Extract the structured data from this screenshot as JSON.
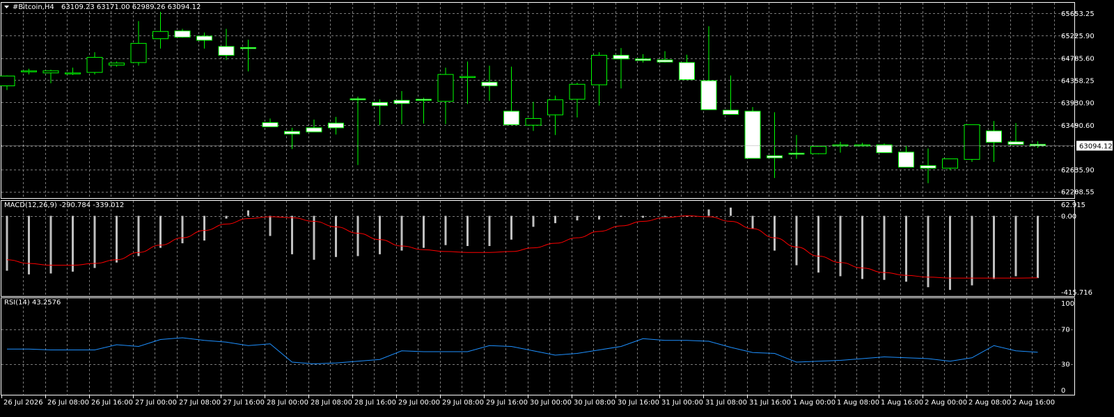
{
  "header": {
    "symbol_label": "#Bitcoin,H4",
    "ohlc": "63109.23 63171.00 62989.26 63094.12",
    "dropdown_icon": "triangle-down-icon"
  },
  "colors": {
    "background": "#000000",
    "grid": "#7a7a7a",
    "bull_body": "#000000",
    "bear_body": "#ffffff",
    "candle_outline": "#00ff00",
    "macd_hist": "#c0c0c0",
    "macd_signal": "#ff0000",
    "rsi_line": "#1e90ff"
  },
  "price_panel": {
    "ticks": [
      "65653.25",
      "65225.90",
      "64785.60",
      "64358.25",
      "63930.90",
      "63490.60",
      "63094.12",
      "62635.90",
      "62208.55"
    ],
    "current_price": "63094.12"
  },
  "macd_panel": {
    "label": "MACD(12,26,9) -290.784 -339.012",
    "ticks": [
      "62.915",
      "0.00",
      "-415.716"
    ]
  },
  "rsi_panel": {
    "label": "RSI(14) 43.2576",
    "ticks": [
      "100",
      "70",
      "30",
      "0"
    ]
  },
  "time_axis": {
    "labels": [
      "26 Jul 2026",
      "26 Jul 08:00",
      "26 Jul 16:00",
      "27 Jul 00:00",
      "27 Jul 08:00",
      "27 Jul 16:00",
      "28 Jul 00:00",
      "28 Jul 08:00",
      "28 Jul 16:00",
      "29 Jul 00:00",
      "29 Jul 08:00",
      "29 Jul 16:00",
      "30 Jul 00:00",
      "30 Jul 08:00",
      "30 Jul 16:00",
      "31 Jul 00:00",
      "31 Jul 08:00",
      "31 Jul 16:00",
      "1 Aug 00:00",
      "1 Aug 08:00",
      "1 Aug 16:00",
      "2 Aug 00:00",
      "2 Aug 08:00",
      "2 Aug 16:00"
    ]
  },
  "chart_data": [
    {
      "type": "candlestick",
      "title": "#Bitcoin,H4",
      "ylim": [
        62150,
        65800
      ],
      "open": [
        64250,
        64530,
        64500,
        64480,
        64510,
        64650,
        64700,
        65160,
        65310,
        65210,
        65010,
        64990,
        63540,
        63370,
        63440,
        63530,
        64000,
        63930,
        63970,
        63990,
        63950,
        64420,
        64320,
        63760,
        63490,
        63690,
        63990,
        64270,
        64840,
        64770,
        64750,
        64700,
        64350,
        63780,
        63760,
        62900,
        62950,
        62940,
        63110,
        63110,
        63110,
        62970,
        62710,
        62660,
        62830,
        63380,
        63170,
        63120
      ],
      "high": [
        64450,
        64580,
        64560,
        64600,
        64900,
        64720,
        65500,
        65680,
        65350,
        65280,
        65350,
        65140,
        63620,
        63440,
        63600,
        63650,
        64040,
        63990,
        64150,
        64020,
        64600,
        64720,
        64640,
        64620,
        63940,
        64060,
        64310,
        64900,
        64980,
        64860,
        64920,
        64850,
        65400,
        64450,
        63840,
        63740,
        63300,
        63020,
        63170,
        63150,
        63140,
        63090,
        63040,
        62690,
        62880,
        63570,
        63530,
        63180
      ],
      "low": [
        64170,
        64470,
        64300,
        64460,
        64470,
        64620,
        64640,
        64970,
        65180,
        64970,
        64750,
        64530,
        63500,
        63030,
        63360,
        63310,
        62720,
        63490,
        63510,
        63520,
        63510,
        63900,
        63960,
        63660,
        63380,
        63300,
        63640,
        63870,
        64200,
        64700,
        64700,
        64680,
        64260,
        63720,
        63620,
        62470,
        62840,
        62930,
        62960,
        63080,
        63080,
        62940,
        62370,
        62620,
        62780,
        62780,
        63120,
        63050
      ],
      "close": [
        64440,
        64540,
        64540,
        64500,
        64800,
        64690,
        65070,
        65300,
        65190,
        65130,
        64840,
        64980,
        63460,
        63320,
        63360,
        63440,
        63980,
        63870,
        63910,
        63970,
        64470,
        64430,
        64250,
        63500,
        63620,
        63980,
        64280,
        64840,
        64770,
        64740,
        64710,
        64370,
        63790,
        63700,
        62850,
        62860,
        62940,
        63080,
        63110,
        63110,
        62960,
        62680,
        62660,
        62840,
        63500,
        63160,
        63120,
        63094.12
      ]
    },
    {
      "type": "bar",
      "title": "MACD(12,26,9)",
      "ylim": [
        -415.716,
        62.915
      ],
      "series": [
        {
          "name": "MACD",
          "values": [
            -300,
            -320,
            -315,
            -305,
            -285,
            -255,
            -220,
            -175,
            -150,
            -135,
            -15,
            30,
            -110,
            -210,
            -240,
            -225,
            -220,
            -210,
            -190,
            -175,
            -160,
            -165,
            -165,
            -130,
            -60,
            -40,
            -25,
            -20,
            -5,
            -10,
            -5,
            -5,
            35,
            45,
            -70,
            -190,
            -270,
            -310,
            -330,
            -345,
            -350,
            -360,
            -390,
            -405,
            -380,
            -345,
            -330,
            -340
          ]
        },
        {
          "name": "Signal",
          "values": [
            -240,
            -260,
            -270,
            -270,
            -260,
            -240,
            -200,
            -160,
            -120,
            -80,
            -45,
            -15,
            -5,
            -10,
            -30,
            -60,
            -95,
            -130,
            -165,
            -185,
            -195,
            -200,
            -200,
            -195,
            -175,
            -150,
            -120,
            -85,
            -55,
            -30,
            -10,
            0,
            -5,
            -30,
            -70,
            -120,
            -170,
            -220,
            -255,
            -285,
            -310,
            -325,
            -335,
            -340,
            -340,
            -340,
            -340,
            -339.012
          ]
        }
      ]
    },
    {
      "type": "line",
      "title": "RSI(14)",
      "ylim": [
        0,
        100
      ],
      "series": [
        {
          "name": "RSI",
          "values": [
            47,
            47,
            46,
            46,
            46,
            52,
            50,
            58,
            60,
            57,
            55,
            51,
            53,
            32,
            30,
            31,
            33,
            35,
            45,
            44,
            44,
            44,
            51,
            50,
            45,
            40,
            42,
            46,
            50,
            59,
            57,
            57,
            56,
            49,
            43,
            42,
            32,
            33,
            34,
            36,
            38,
            37,
            36,
            33,
            37,
            51,
            45,
            43.2576
          ]
        }
      ]
    }
  ]
}
